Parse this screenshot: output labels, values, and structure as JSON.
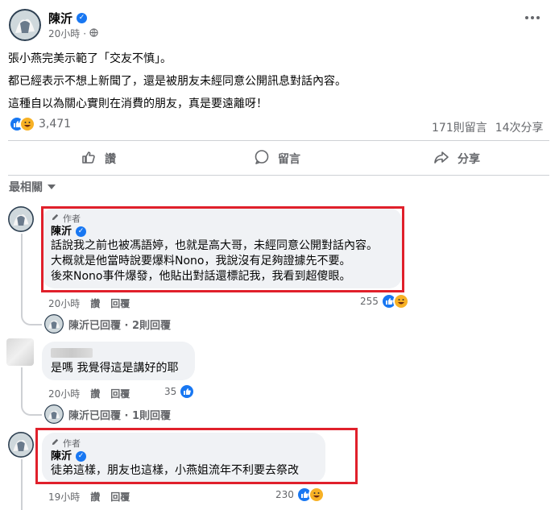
{
  "post": {
    "author": "陳沂",
    "time": "20小時",
    "globe_icon": "globe-icon",
    "lines": [
      "張小燕完美示範了「交友不慎」。",
      "都已經表示不想上新聞了，還是被朋友未經同意公開訊息對話內容。",
      "這種自以為關心實則在消費的朋友，真是要遠離呀！"
    ],
    "reaction_count": "3,471",
    "comment_count": "171則留言",
    "share_count": "14次分享"
  },
  "actions": {
    "like": "讚",
    "comment": "留言",
    "share": "分享"
  },
  "sort_label": "最相關",
  "comments": [
    {
      "author_tag": "作者",
      "name": "陳沂",
      "lines": [
        "話說我之前也被馮語婷，也就是高大哥，未經同意公開對話內容。",
        "大概就是他當時說要爆料Nono，我說沒有足夠證據先不要。",
        "後來Nono事件爆發，他貼出對話還標記我，我看到超傻眼。"
      ],
      "time": "20小時",
      "like": "讚",
      "reply": "回覆",
      "reactions": "255",
      "replies": "陳沂已回覆 · 2則回覆"
    },
    {
      "lines": [
        "是嗎 我覺得這是講好的耶"
      ],
      "time": "20小時",
      "like": "讚",
      "reply": "回覆",
      "reactions": "35",
      "replies": "陳沂已回覆 · 1則回覆"
    },
    {
      "author_tag": "作者",
      "name": "陳沂",
      "lines": [
        "徒弟這樣，朋友也這樣，小燕姐流年不利要去祭改"
      ],
      "time": "19小時",
      "like": "讚",
      "reply": "回覆",
      "reactions": "230"
    }
  ],
  "colors": {
    "accent": "#1877f2",
    "highlight_box": "#e0202b",
    "bubble_bg": "#f0f2f5",
    "secondary_text": "#65676b"
  }
}
